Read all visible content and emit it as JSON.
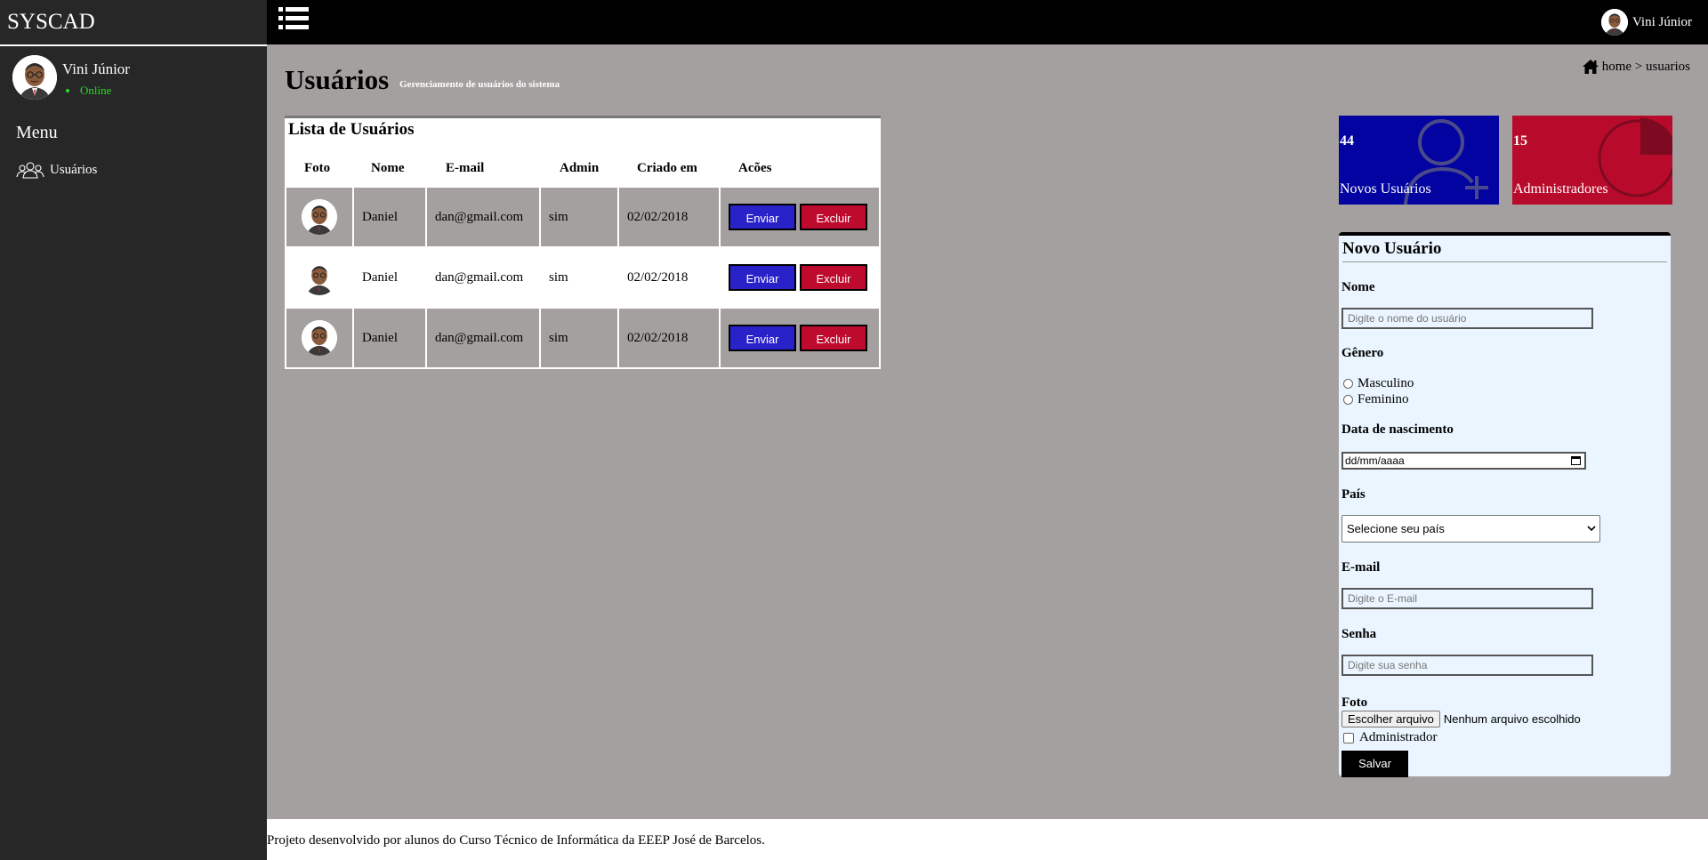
{
  "app": {
    "brand": "SYSCAD"
  },
  "sidebar": {
    "user_name": "Vini Júnior",
    "user_status": "Online",
    "menu_title": "Menu",
    "items": [
      {
        "label": "Usuários",
        "icon": "users-icon"
      }
    ]
  },
  "topbar": {
    "user_name": "Vini Júnior"
  },
  "page": {
    "title": "Usuários",
    "subtitle": "Gerenciamento de usuários do sistema",
    "breadcrumb": "home > usuarios"
  },
  "users_table": {
    "heading": "Lista de Usuários",
    "columns": [
      "Foto",
      "Nome",
      "E-mail",
      "Admin",
      "Criado em",
      "Acões"
    ],
    "rows": [
      {
        "name": "Daniel",
        "email": "dan@gmail.com",
        "admin": "sim",
        "created": "02/02/2018"
      },
      {
        "name": "Daniel",
        "email": "dan@gmail.com",
        "admin": "sim",
        "created": "02/02/2018"
      },
      {
        "name": "Daniel",
        "email": "dan@gmail.com",
        "admin": "sim",
        "created": "02/02/2018"
      }
    ],
    "send_label": "Enviar",
    "delete_label": "Excluir"
  },
  "stats": {
    "new_users": {
      "value": "44",
      "label": "Novos Usuários",
      "color": "#0303a1"
    },
    "admins": {
      "value": "15",
      "label": "Administradores",
      "color": "#b80b2b"
    }
  },
  "form": {
    "title": "Novo Usuário",
    "name_label": "Nome",
    "name_placeholder": "Digite o nome do usuário",
    "gender_label": "Gênero",
    "gender_options": [
      "Masculino",
      "Feminino"
    ],
    "birth_label": "Data de nascimento",
    "birth_placeholder": "dd/mm/aaaa",
    "country_label": "País",
    "country_selected": "Selecione seu país",
    "email_label": "E-mail",
    "email_placeholder": "Digite o E-mail",
    "password_label": "Senha",
    "password_placeholder": "Digite sua senha",
    "photo_label": "Foto",
    "file_button": "Escolher arquivo",
    "file_status": "Nenhum arquivo escolhido",
    "admin_label": "Administrador",
    "save_label": "Salvar"
  },
  "footer": {
    "text": "Projeto desenvolvido por alunos do Curso Técnico de Informática da EEEP José de Barcelos."
  }
}
